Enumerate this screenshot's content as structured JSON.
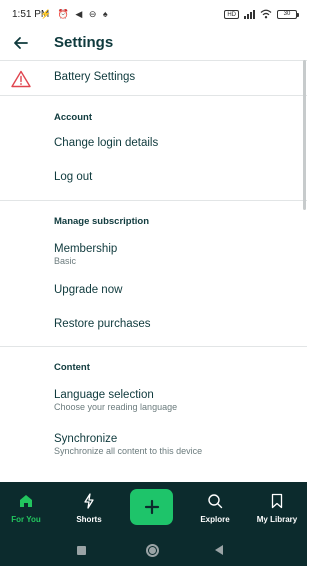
{
  "status_bar": {
    "time": "1:51 PM",
    "left_icons": "⚡ ⏰ ◀ ⊖ ♠",
    "network_badge": "HD",
    "battery": "30"
  },
  "header": {
    "back_icon": "arrow-left-icon",
    "title": "Settings"
  },
  "warning_row": {
    "icon": "warning-triangle-icon",
    "label": "Battery Settings",
    "icon_color": "#e0454f"
  },
  "sections": [
    {
      "header": "Account",
      "items": [
        {
          "title": "Change login details"
        },
        {
          "title": "Log out"
        }
      ]
    },
    {
      "header": "Manage subscription",
      "items": [
        {
          "title": "Membership",
          "subtitle": "Basic"
        },
        {
          "title": "Upgrade now"
        },
        {
          "title": "Restore purchases"
        }
      ]
    },
    {
      "header": "Content",
      "items": [
        {
          "title": "Language selection",
          "subtitle": "Choose your reading language"
        },
        {
          "title": "Synchronize",
          "subtitle": "Synchronize all content to this device"
        }
      ]
    }
  ],
  "bottom_nav": {
    "items": [
      {
        "label": "For You",
        "icon": "home-icon",
        "active": true
      },
      {
        "label": "Shorts",
        "icon": "lightning-icon",
        "active": false
      },
      {
        "label": "Explore",
        "icon": "search-icon",
        "active": false
      },
      {
        "label": "My Library",
        "icon": "bookmark-icon",
        "active": false
      }
    ],
    "fab_icon": "plus-icon"
  },
  "colors": {
    "accent": "#1ec46a",
    "nav_background": "#0c2b2d",
    "text": "#0f3a3d"
  }
}
